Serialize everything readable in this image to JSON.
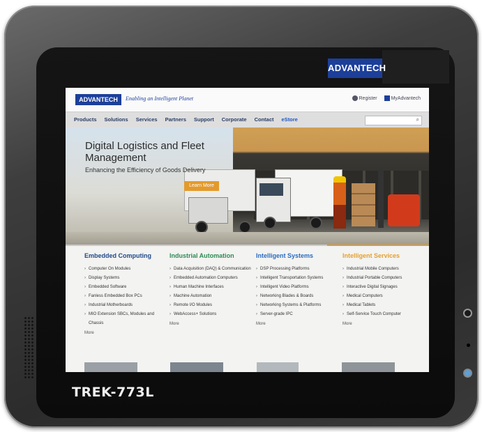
{
  "device": {
    "brand_badge": "ADVANTECH",
    "model_label": "TREK-773L"
  },
  "website": {
    "logo": "ADVANTECH",
    "tagline": "Enabling an Intelligent Planet",
    "top_links": {
      "register": "Register",
      "my_account": "MyAdvantech"
    },
    "nav": [
      "Products",
      "Solutions",
      "Services",
      "Partners",
      "Support",
      "Corporate",
      "Contact",
      "eStore"
    ],
    "search_placeholder": "",
    "hero": {
      "title": "Digital Logistics and Fleet Management",
      "subtitle": "Enhancing the Efficiency of Goods Delivery",
      "cta": "Learn More"
    },
    "columns": [
      {
        "title": "Embedded Computing",
        "items": [
          "Computer On Modules",
          "Display Systems",
          "Embedded Software",
          "Fanless Embedded Box PCs",
          "Industrial Motherboards",
          "MIO Extension SBCs, Modules and Chassis"
        ],
        "more": "More"
      },
      {
        "title": "Industrial Automation",
        "items": [
          "Data Acquisition (DAQ) & Communication",
          "Embedded Automation Computers",
          "Human Machine Interfaces",
          "Machine Automation",
          "Remote I/O Modules",
          "WebAccess+ Solutions"
        ],
        "more": "More"
      },
      {
        "title": "Intelligent Systems",
        "items": [
          "DSP Processing Platforms",
          "Intelligent Transportation Systems",
          "Intelligent Video Platforms",
          "Networking Blades & Boards",
          "Networking Systems & Platforms",
          "Server-grade IPC"
        ],
        "more": "More"
      },
      {
        "title": "Intelligent Services",
        "items": [
          "Industrial Mobile Computers",
          "Industrial Portable Computers",
          "Interactive Digital Signages",
          "Medical Computers",
          "Medical Tablets",
          "Self-Service Touch Computer"
        ],
        "more": "More"
      }
    ]
  },
  "colors": {
    "brand_blue": "#1c3f9a",
    "accent_orange": "#e39a2c",
    "bezel": "#2c2c2c"
  }
}
